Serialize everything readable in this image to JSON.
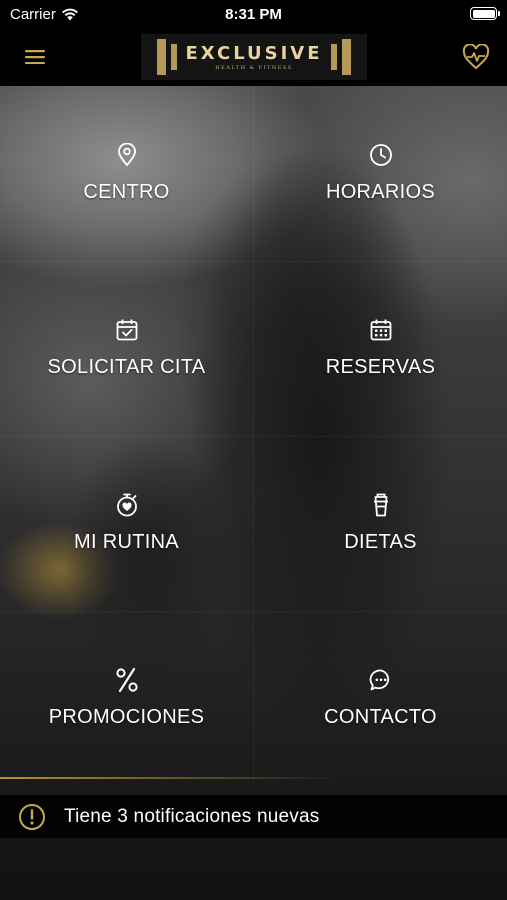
{
  "status_bar": {
    "carrier": "Carrier",
    "time": "8:31 PM"
  },
  "header": {
    "logo_title": "EXCLUSIVE",
    "logo_subtitle": "HEALTH & FITNESS",
    "menu_icon": "hamburger-menu-icon",
    "right_icon": "heart-pulse-icon"
  },
  "colors": {
    "accent": "#b49a56",
    "background": "#000000",
    "text": "#ffffff"
  },
  "menu": {
    "items": [
      {
        "label": "CENTRO",
        "icon": "location-pin-icon"
      },
      {
        "label": "HORARIOS",
        "icon": "clock-icon"
      },
      {
        "label": "SOLICITAR CITA",
        "icon": "calendar-check-icon"
      },
      {
        "label": "RESERVAS",
        "icon": "calendar-grid-icon"
      },
      {
        "label": "MI RUTINA",
        "icon": "stopwatch-heart-icon"
      },
      {
        "label": "DIETAS",
        "icon": "drink-cup-icon"
      },
      {
        "label": "PROMOCIONES",
        "icon": "percent-icon"
      },
      {
        "label": "CONTACTO",
        "icon": "chat-bubble-icon"
      }
    ]
  },
  "notification": {
    "text": "Tiene 3 notificaciones nuevas",
    "icon": "alert-circle-icon"
  }
}
